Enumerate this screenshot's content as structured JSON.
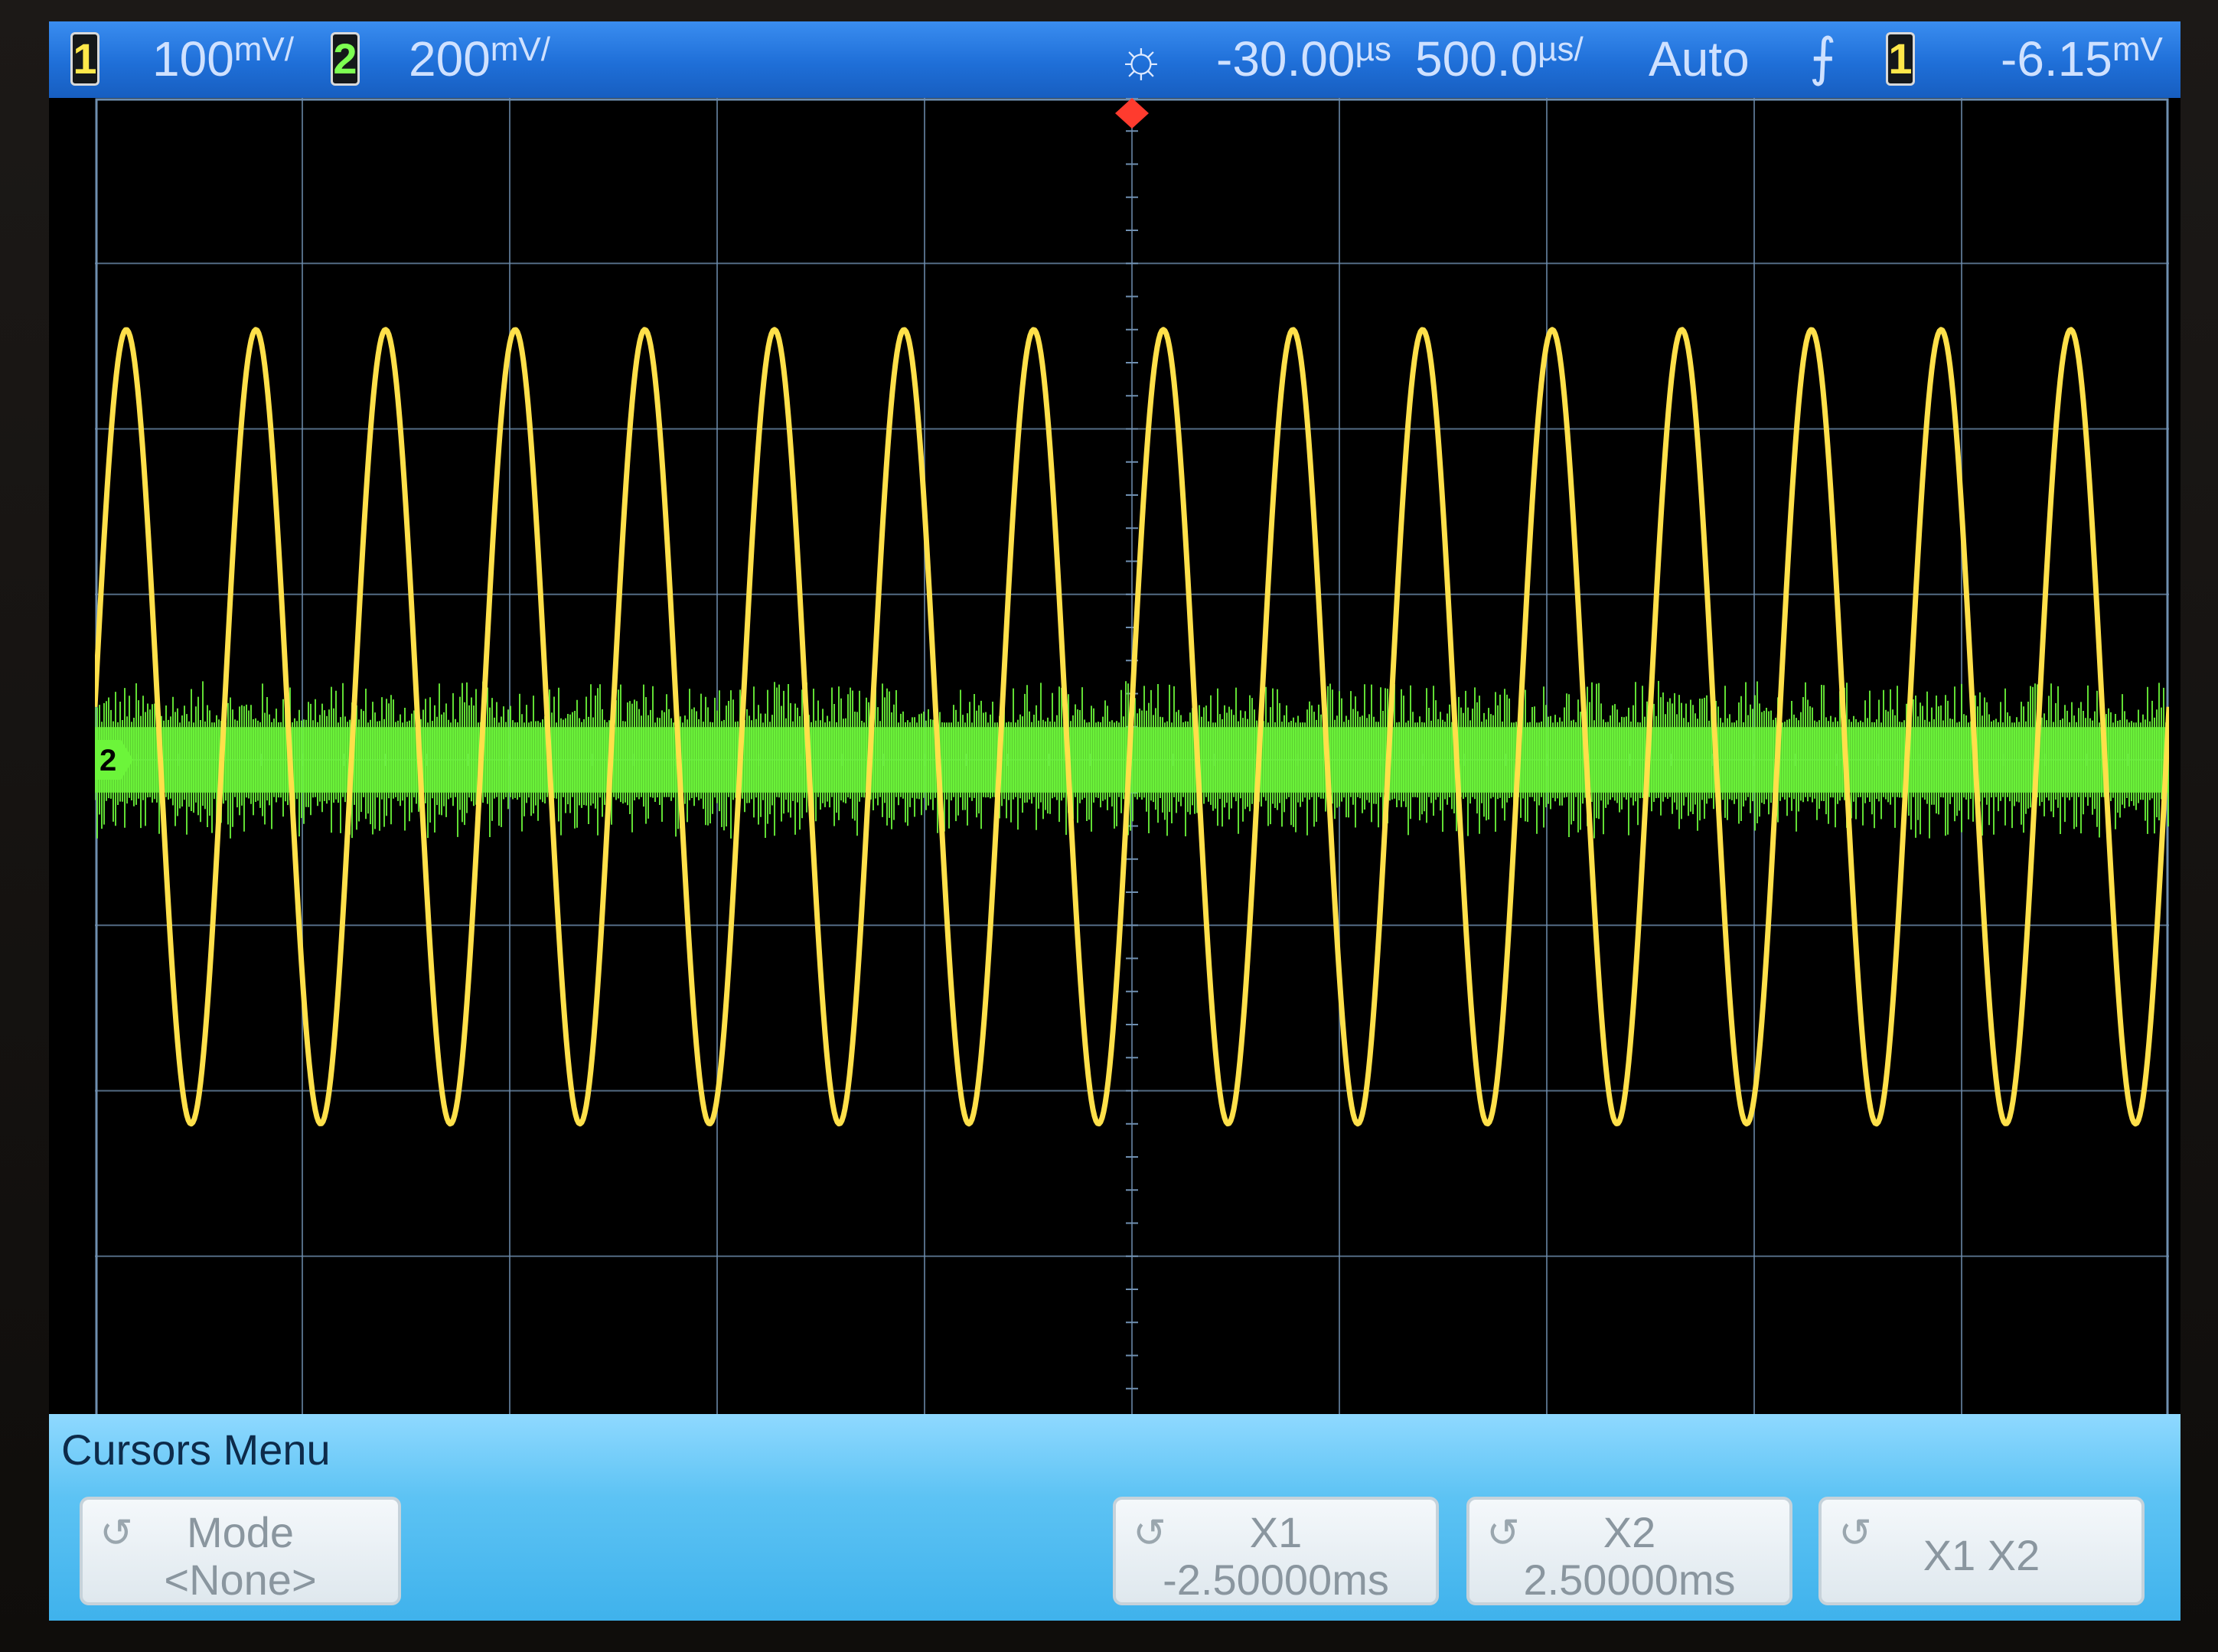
{
  "topbar": {
    "ch1": {
      "badge": "1",
      "scale_value": "100",
      "scale_unit": "mV/"
    },
    "ch2": {
      "badge": "2",
      "scale_value": "200",
      "scale_unit": "mV/"
    },
    "time_offset_value": "-30.00",
    "time_offset_unit": "µs",
    "timebase_value": "500.0",
    "timebase_unit": "µs/",
    "trigger_mode": "Auto",
    "trigger_source": "1",
    "trigger_level_value": "-6.15",
    "trigger_level_unit": "mV"
  },
  "marker": {
    "ch2_ground": "2"
  },
  "menu": {
    "title": "Cursors Menu",
    "keys": [
      {
        "line1": "Mode",
        "line2": "<None>"
      },
      {
        "line1": "X1",
        "line2": "-2.50000ms"
      },
      {
        "line1": "X2",
        "line2": "2.50000ms"
      },
      {
        "label": "X1 X2"
      }
    ]
  },
  "colors": {
    "ch1": "#ffe04a",
    "ch2": "#6cf53a",
    "grid": "#6f8fb0",
    "topbar": "#2477dc",
    "menu": "#5dc3f4"
  },
  "chart_data": {
    "type": "line",
    "title": "",
    "xlabel": "",
    "ylabel": "",
    "grid": true,
    "divisions": {
      "x": 10,
      "y": 8
    },
    "series": [
      {
        "name": "1",
        "waveform": "sine",
        "cycles_on_screen": 16,
        "peak_to_peak_divisions": 4.8,
        "center_division": 0.2
      },
      {
        "name": "2",
        "waveform": "noise",
        "band_divisions": 0.9,
        "center_division": 0
      }
    ]
  }
}
